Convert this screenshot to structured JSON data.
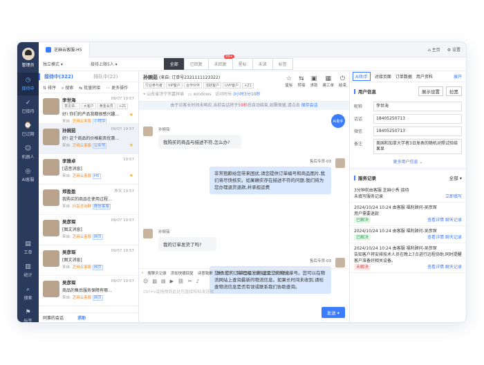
{
  "nav": {
    "role": "管理员",
    "items": [
      {
        "icon": "◷",
        "label": "接待中"
      },
      {
        "icon": "✓",
        "label": "已接待"
      },
      {
        "icon": "⌚",
        "label": "已过期"
      },
      {
        "icon": "☺",
        "label": "机器人"
      },
      {
        "icon": "◎",
        "label": "AI客服"
      },
      {
        "icon": "▤",
        "label": "工单"
      },
      {
        "icon": "▥",
        "label": "统计"
      },
      {
        "icon": "⌕",
        "label": "搜索"
      },
      {
        "icon": "⚑",
        "label": "标签"
      },
      {
        "icon": "⚙",
        "label": "设置"
      }
    ]
  },
  "topbar": {
    "tab": "芝麻云客服-H5",
    "home": "主页",
    "settings": "设置"
  },
  "filter": {
    "mode": "独立模式",
    "limit": "接待上限5人",
    "segments": [
      "全部",
      "已回复",
      "未回复",
      "星标",
      "未读",
      "标签"
    ],
    "badge": "99+"
  },
  "list": {
    "tab_active": "接待中(322)",
    "tab_queue": "排队中(22)",
    "tools": [
      "排序",
      "搜索",
      "批量转接",
      "更多操作"
    ],
    "items": [
      {
        "name": "李世海",
        "time": "09/07 19:57",
        "tags": [
          "意见领...",
          "大客户",
          "黄金会员",
          "+21"
        ],
        "msg": "好! 你们的产品我都很感兴趣...",
        "src": "芝麻云客服",
        "ch": "小程序"
      },
      {
        "name": "孙婉茹",
        "time": "09/07 19:57",
        "msg": "好! 这个商品的价格能否优惠...",
        "src": "芝麻云客服",
        "ch": "公众号"
      },
      {
        "name": "李雅卓",
        "time": "19:57",
        "msg": "[语音消息]",
        "src": "芝麻云客服",
        "ch": "H5"
      },
      {
        "name": "郑盈盈",
        "time": "昨天 19:57",
        "msg": "我购买的商品在使用过程...",
        "src": "抖音咨询群",
        "ch": "微信客服"
      },
      {
        "name": "吴彦琛",
        "time": "09/07 19:57",
        "msg": "[图文消息]",
        "src": "芝麻云客服",
        "ch": "网页"
      },
      {
        "name": "吴彦琛",
        "time": "09/07 19:57",
        "msg": "[图文消息]",
        "src": "芝麻云客服",
        "ch": "网页"
      },
      {
        "name": "吴彦琛",
        "time": "09/07 19:57",
        "msg": "商品的售后服务保障有哪...",
        "src": "芝麻云客服",
        "ch": "网页"
      }
    ],
    "foot_left": "同事的会话",
    "foot_right": "求助"
  },
  "chat": {
    "name": "孙婉茹",
    "sub": "(来自: 订单号2321111123322)",
    "tags": [
      "行业参与者",
      "VIP客户",
      "合作伙伴",
      "活跃客户",
      "UVP客户",
      "+21"
    ],
    "loc": "山东省济宁市嘉祥县",
    "os": "windows",
    "wait_label": "访问时长",
    "wait": "0小时3分10秒",
    "tools": [
      {
        "icon": "☆",
        "label": "星标"
      },
      {
        "icon": "⇆",
        "label": "转接"
      },
      {
        "icon": "▣",
        "label": "求助"
      },
      {
        "icon": "▦",
        "label": "建工单"
      },
      {
        "icon": "⏻",
        "label": "结束"
      }
    ],
    "notice_a": "由于访客长时间未响应,当前会话将于",
    "notice_num": "59秒",
    "notice_b": "后自动结束,如需保留,请点击",
    "notice_link": "保存会话",
    "messages": [
      {
        "who": "孙婉茹",
        "text": "我购买的商品与描述不符,怎么办?"
      },
      {
        "who": "售后专员-03",
        "text": "非常抱歉给您带来困扰,请您提供订单编号和商品图片,我们将尽快核实。如果确实存在描述不符的问题,我们将为您办理退货退款,并承担运费"
      },
      {
        "who": "孙婉茹",
        "text": "我的订单发货了吗?"
      },
      {
        "who": "售后专员-03",
        "text": "您好,您的订单已经发货,这是您的物流单号。您可以在物流网站上查询最新的物流信息。如果长时间未收到,请检查物流信息是否有误或联系我们协助查询。"
      }
    ],
    "quick": [
      "搜聊天记录",
      "添加快捷回复",
      "诗意致歉",
      "美食天下",
      "健康管家",
      "健康管家",
      "快乐伤心"
    ],
    "placeholder": "ctrl+v或拖拽到此处可直接粘贴发送图",
    "send": "发送",
    "ai": "AI助手"
  },
  "side": {
    "tabs": [
      "AI助手",
      "对接页面",
      "订单数据",
      "用户资料",
      "展开"
    ],
    "info_title": "用户信息",
    "btn_show": "展示设置",
    "btn_pull": "拉黑",
    "fields": [
      {
        "k": "昵称",
        "v": "李世海"
      },
      {
        "k": "话话",
        "v": "18405250713"
      },
      {
        "k": "微信",
        "v": "18405250713"
      },
      {
        "k": "备注",
        "v": "美国和加拿大学者3日发表的随机对照试验结果显"
      }
    ],
    "more": "更多用户信息",
    "rec_title": "服务记录",
    "rec_filter": "全部",
    "records": [
      {
        "title": "3分钟前由客服 芝麻小秀 接待",
        "desc": "未填写服务记录",
        "status": "",
        "link": "立即填写"
      },
      {
        "title": "2024/10/24 10:24 由客服 福利顾问-吴彦琛",
        "desc": "用户需要退款",
        "status": "已解决",
        "link": "查看详情  聊天记录"
      },
      {
        "title": "2024/10/24 10:24 由客服 福利顾问-吴彦琛",
        "desc": "",
        "status": "已解决",
        "link": "查看详情  聊天记录"
      },
      {
        "title": "2024/10/24 10:24 由客服 福利顾问-吴彦琛",
        "desc": "告知客户将安排技术人员在晚上7点进行远程协助,同时提醒客户准备好相关设备。",
        "status": "未解决",
        "link": "查看详情  聊天记录"
      }
    ]
  }
}
